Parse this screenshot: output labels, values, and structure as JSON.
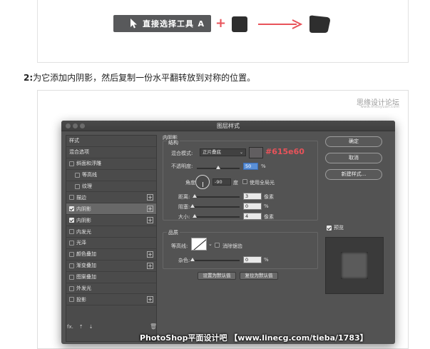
{
  "top": {
    "tool_label": "直接选择工具",
    "tool_key": "A",
    "plus": "+"
  },
  "step": {
    "number": "2:",
    "text": "为它添加内阴影，然后复制一份水平翻转放到对称的位置。"
  },
  "watermark": {
    "site_cn": "思缘设计论坛",
    "site_url": "www.missyuan.com"
  },
  "dialog": {
    "title": "图层样式",
    "styles": [
      {
        "label": "样式",
        "checkbox": false,
        "indent": false,
        "plus": false,
        "selected": false
      },
      {
        "label": "混合选项",
        "checkbox": false,
        "indent": false,
        "plus": false,
        "selected": false
      },
      {
        "label": "斜面和浮雕",
        "checkbox": true,
        "checked": false,
        "indent": false,
        "plus": false,
        "selected": false
      },
      {
        "label": "等高线",
        "checkbox": true,
        "checked": false,
        "indent": true,
        "plus": false,
        "selected": false
      },
      {
        "label": "纹理",
        "checkbox": true,
        "checked": false,
        "indent": true,
        "plus": false,
        "selected": false
      },
      {
        "label": "描边",
        "checkbox": true,
        "checked": false,
        "indent": false,
        "plus": true,
        "selected": false
      },
      {
        "label": "内阴影",
        "checkbox": true,
        "checked": true,
        "indent": false,
        "plus": true,
        "selected": true
      },
      {
        "label": "内阴影",
        "checkbox": true,
        "checked": true,
        "indent": false,
        "plus": true,
        "selected": false
      },
      {
        "label": "内发光",
        "checkbox": true,
        "checked": false,
        "indent": false,
        "plus": false,
        "selected": false
      },
      {
        "label": "光泽",
        "checkbox": true,
        "checked": false,
        "indent": false,
        "plus": false,
        "selected": false
      },
      {
        "label": "颜色叠加",
        "checkbox": true,
        "checked": false,
        "indent": false,
        "plus": true,
        "selected": false
      },
      {
        "label": "渐变叠加",
        "checkbox": true,
        "checked": false,
        "indent": false,
        "plus": true,
        "selected": false
      },
      {
        "label": "图案叠加",
        "checkbox": true,
        "checked": false,
        "indent": false,
        "plus": false,
        "selected": false
      },
      {
        "label": "外发光",
        "checkbox": true,
        "checked": false,
        "indent": false,
        "plus": false,
        "selected": false
      },
      {
        "label": "投影",
        "checkbox": true,
        "checked": false,
        "indent": false,
        "plus": true,
        "selected": false
      }
    ],
    "footer_fx": "fx.",
    "section_title": "内阴影",
    "structure_title": "结构",
    "blend_mode_label": "混合模式:",
    "blend_mode_value": "正片叠底",
    "color_hex": "#615e60",
    "color_note": "#615e60",
    "opacity_label": "不透明度:",
    "opacity_value": "50",
    "angle_label": "角度:",
    "angle_value": "-90",
    "angle_unit": "度",
    "global_light_label": "使用全局光",
    "distance_label": "距离:",
    "distance_value": "3",
    "choke_label": "阻塞:",
    "choke_value": "0",
    "size_label": "大小:",
    "size_value": "4",
    "px_unit": "像素",
    "pct_unit": "%",
    "quality_title": "品质",
    "contour_label": "等高线:",
    "antialias_label": "消除锯齿",
    "noise_label": "杂色:",
    "noise_value": "0",
    "set_default": "设置为默认值",
    "reset_default": "复位为默认值",
    "ok": "确定",
    "cancel": "取消",
    "new_style": "新建样式...",
    "preview_label": "预览"
  },
  "bottom_watermark": "PhotoShop平面设计吧 【www.linecg.com/tieba/1783】"
}
